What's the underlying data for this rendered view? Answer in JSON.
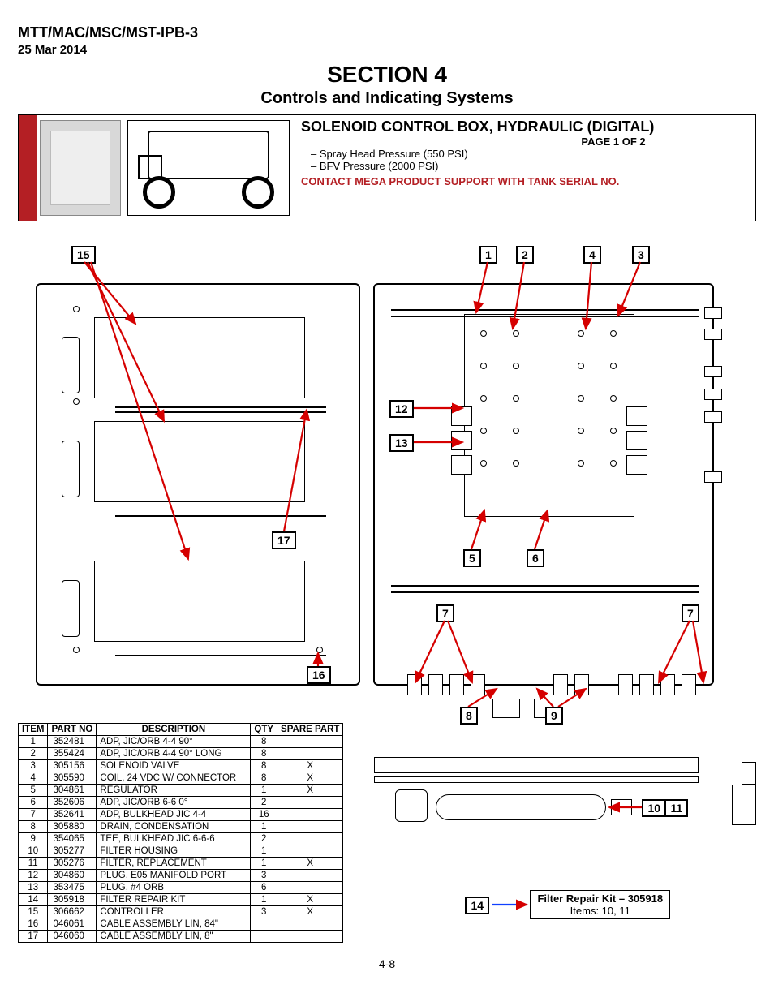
{
  "header": {
    "doc_id": "MTT/MAC/MSC/MST-IPB-3",
    "date": "25 Mar 2014",
    "section": "SECTION 4",
    "subtitle": "Controls and Indicating Systems"
  },
  "topbox": {
    "title": "SOLENOID CONTROL BOX, HYDRAULIC (DIGITAL)",
    "page": "PAGE 1 OF 2",
    "bullets": [
      "Spray Head Pressure (550 PSI)",
      "BFV Pressure (2000 PSI)"
    ],
    "contact": "CONTACT MEGA PRODUCT SUPPORT WITH TANK SERIAL NO."
  },
  "callouts": [
    "1",
    "2",
    "3",
    "4",
    "5",
    "6",
    "7",
    "7",
    "8",
    "9",
    "10",
    "11",
    "12",
    "13",
    "14",
    "15",
    "16",
    "17"
  ],
  "table": {
    "headers": [
      "ITEM",
      "PART NO",
      "DESCRIPTION",
      "QTY",
      "SPARE PART"
    ],
    "rows": [
      [
        "1",
        "352481",
        "ADP,  JIC/ORB 4-4 90°",
        "8",
        ""
      ],
      [
        "2",
        "355424",
        "ADP,  JIC/ORB 4-4 90° LONG",
        "8",
        ""
      ],
      [
        "3",
        "305156",
        "SOLENOID VALVE",
        "8",
        "X"
      ],
      [
        "4",
        "305590",
        "COIL, 24 VDC W/ CONNECTOR",
        "8",
        "X"
      ],
      [
        "5",
        "304861",
        "REGULATOR",
        "1",
        "X"
      ],
      [
        "6",
        "352606",
        "ADP, JIC/ORB 6-6 0°",
        "2",
        ""
      ],
      [
        "7",
        "352641",
        "ADP, BULKHEAD JIC 4-4",
        "16",
        ""
      ],
      [
        "8",
        "305880",
        "DRAIN, CONDENSATION",
        "1",
        ""
      ],
      [
        "9",
        "354065",
        "TEE, BULKHEAD JIC 6-6-6",
        "2",
        ""
      ],
      [
        "10",
        "305277",
        "FILTER HOUSING",
        "1",
        ""
      ],
      [
        "11",
        "305276",
        "FILTER, REPLACEMENT",
        "1",
        "X"
      ],
      [
        "12",
        "304860",
        "PLUG, E05 MANIFOLD PORT",
        "3",
        ""
      ],
      [
        "13",
        "353475",
        "PLUG, #4 ORB",
        "6",
        ""
      ],
      [
        "14",
        "305918",
        "FILTER REPAIR KIT",
        "1",
        "X"
      ],
      [
        "15",
        "306662",
        "CONTROLLER",
        "3",
        "X"
      ],
      [
        "16",
        "046061",
        "CABLE ASSEMBLY LIN, 84\"",
        "",
        ""
      ],
      [
        "17",
        "046060",
        "CABLE ASSEMBLY LIN, 8\"",
        "",
        ""
      ]
    ]
  },
  "filter_kit": {
    "title": "Filter Repair Kit – 305918",
    "items": "Items: 10, 11",
    "callouts": [
      "10",
      "11",
      "14"
    ]
  },
  "footer": "4-8"
}
